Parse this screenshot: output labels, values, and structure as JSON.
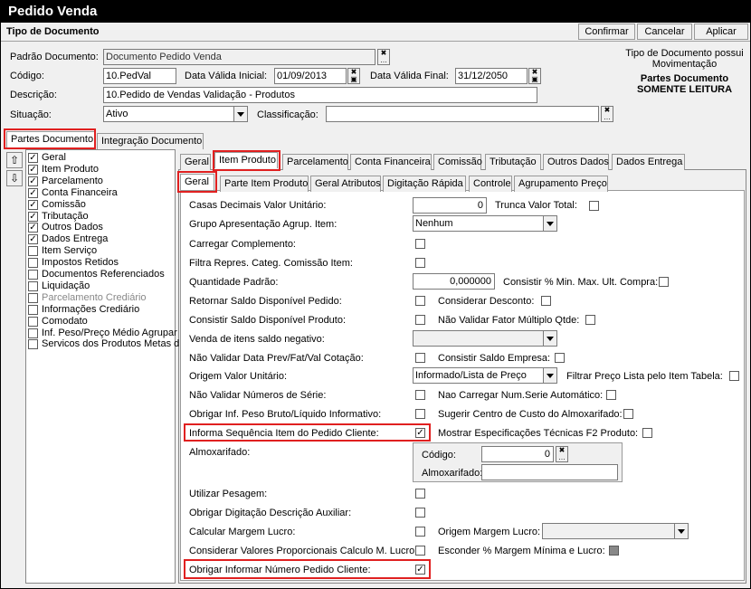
{
  "window": {
    "title": "Pedido Venda"
  },
  "header": {
    "title": "Tipo de Documento",
    "buttons": [
      "Confirmar",
      "Cancelar",
      "Aplicar"
    ]
  },
  "info": {
    "line1": "Tipo de Documento possui",
    "line2": "Movimentação",
    "line3": "Partes Documento",
    "line4": "SOMENTE LEITURA"
  },
  "form": {
    "padrao_label": "Padrão Documento:",
    "padrao_value": "Documento Pedido Venda",
    "codigo_label": "Código:",
    "codigo_value": "10.PedVal",
    "dvi_label": "Data Válida Inicial:",
    "dvi_value": "01/09/2013",
    "dvf_label": "Data Válida Final:",
    "dvf_value": "31/12/2050",
    "descricao_label": "Descrição:",
    "descricao_value": "10.Pedido de Vendas Validação - Produtos",
    "situacao_label": "Situação:",
    "situacao_value": "Ativo",
    "classificacao_label": "Classificação:",
    "classificacao_value": ""
  },
  "outer_tabs": [
    "Partes Documento",
    "Integração Documento"
  ],
  "tree": [
    {
      "label": "Geral",
      "checked": true
    },
    {
      "label": "Item Produto",
      "checked": true
    },
    {
      "label": "Parcelamento",
      "checked": true
    },
    {
      "label": "Conta Financeira",
      "checked": true
    },
    {
      "label": "Comissão",
      "checked": true
    },
    {
      "label": "Tributação",
      "checked": true
    },
    {
      "label": "Outros Dados",
      "checked": true
    },
    {
      "label": "Dados Entrega",
      "checked": true
    },
    {
      "label": "Item Serviço",
      "checked": false
    },
    {
      "label": "Impostos Retidos",
      "checked": false
    },
    {
      "label": "Documentos Referenciados",
      "checked": false
    },
    {
      "label": "Liquidação",
      "checked": false
    },
    {
      "label": "Parcelamento Crediário",
      "checked": false
    },
    {
      "label": "Informações Crediário",
      "checked": false
    },
    {
      "label": "Comodato",
      "checked": false
    },
    {
      "label": "Inf. Peso/Preço Médio Agrupar",
      "checked": false
    },
    {
      "label": "Servicos dos Produtos Metas d",
      "checked": false
    }
  ],
  "tabs1": [
    "Geral",
    "Item Produto",
    "Parcelamento",
    "Conta Financeira",
    "Comissão",
    "Tributação",
    "Outros Dados",
    "Dados Entrega"
  ],
  "tabs2": [
    "Geral",
    "Parte Item Produto",
    "Geral Atributos",
    "Digitação Rápida",
    "Controle",
    "Agrupamento Preço"
  ],
  "fields": {
    "casas_label": "Casas Decimais Valor Unitário:",
    "casas_value": "0",
    "trunca_label": "Trunca Valor Total:",
    "grupo_label": "Grupo Apresentação Agrup. Item:",
    "grupo_value": "Nenhum",
    "carregar_label": "Carregar Complemento:",
    "filtra_label": "Filtra Repres. Categ. Comissão Item:",
    "qtd_label": "Quantidade Padrão:",
    "qtd_value": "0,000000",
    "consistir_pct_label": "Consistir % Min. Max. Ult. Compra:",
    "retornar_label": "Retornar Saldo Disponível Pedido:",
    "considerar_desc_label": "Considerar Desconto:",
    "consistir_saldo_label": "Consistir Saldo Disponível Produto:",
    "nao_validar_fator_label": "Não Validar Fator Múltiplo Qtde:",
    "venda_label": "Venda de itens saldo negativo:",
    "venda_value": "",
    "nao_validar_data_label": "Não Validar Data Prev/Fat/Val Cotação:",
    "consistir_empresa_label": "Consistir Saldo Empresa:",
    "origem_label": "Origem Valor Unitário:",
    "origem_value": "Informado/Lista de Preço",
    "filtrar_preco_label": "Filtrar Preço Lista pelo Item Tabela:",
    "nao_validar_serie_label": "Não Validar Números de Série:",
    "nao_carregar_label": "Nao Carregar Num.Serie Automático:",
    "obrigar_peso_label": "Obrigar Inf. Peso Bruto/Líquido Informativo:",
    "sugerir_label": "Sugerir Centro de Custo do Almoxarifado:",
    "informa_seq_label": "Informa Sequência Item do Pedido Cliente:",
    "mostrar_label": "Mostrar Especificações Técnicas F2 Produto:",
    "almox_label": "Almoxarifado:",
    "almox_codigo_label": "Código:",
    "almox_codigo_value": "0",
    "almox_almox_label": "Almoxarifado:",
    "almox_almox_value": "",
    "utilizar_label": "Utilizar Pesagem:",
    "obrigar_desc_label": "Obrigar Digitação Descrição Auxiliar:",
    "calcular_label": "Calcular Margem Lucro:",
    "origem_margem_label": "Origem Margem Lucro:",
    "origem_margem_value": "",
    "considerar_prop_label": "Considerar Valores Proporcionais Calculo M. Lucro:",
    "esconder_label": "Esconder % Margem Mínima e Lucro:",
    "obrigar_num_label": "Obrigar Informar Número Pedido Cliente:"
  },
  "checkmark": "✓"
}
